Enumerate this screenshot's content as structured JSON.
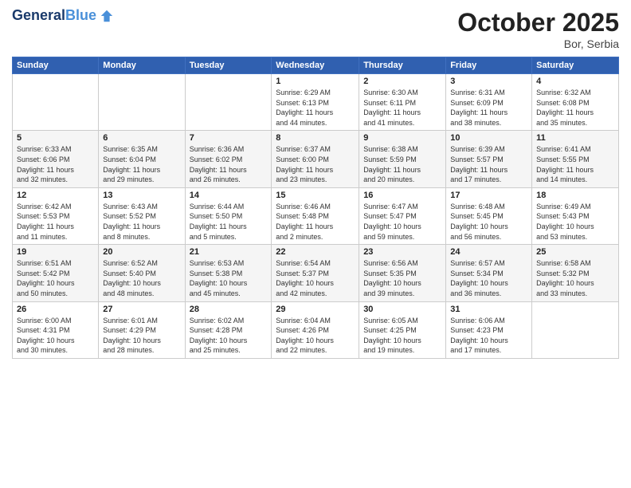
{
  "header": {
    "logo_line1": "General",
    "logo_line2": "Blue",
    "month": "October 2025",
    "location": "Bor, Serbia"
  },
  "days_of_week": [
    "Sunday",
    "Monday",
    "Tuesday",
    "Wednesday",
    "Thursday",
    "Friday",
    "Saturday"
  ],
  "weeks": [
    [
      {
        "day": "",
        "info": ""
      },
      {
        "day": "",
        "info": ""
      },
      {
        "day": "",
        "info": ""
      },
      {
        "day": "1",
        "info": "Sunrise: 6:29 AM\nSunset: 6:13 PM\nDaylight: 11 hours\nand 44 minutes."
      },
      {
        "day": "2",
        "info": "Sunrise: 6:30 AM\nSunset: 6:11 PM\nDaylight: 11 hours\nand 41 minutes."
      },
      {
        "day": "3",
        "info": "Sunrise: 6:31 AM\nSunset: 6:09 PM\nDaylight: 11 hours\nand 38 minutes."
      },
      {
        "day": "4",
        "info": "Sunrise: 6:32 AM\nSunset: 6:08 PM\nDaylight: 11 hours\nand 35 minutes."
      }
    ],
    [
      {
        "day": "5",
        "info": "Sunrise: 6:33 AM\nSunset: 6:06 PM\nDaylight: 11 hours\nand 32 minutes."
      },
      {
        "day": "6",
        "info": "Sunrise: 6:35 AM\nSunset: 6:04 PM\nDaylight: 11 hours\nand 29 minutes."
      },
      {
        "day": "7",
        "info": "Sunrise: 6:36 AM\nSunset: 6:02 PM\nDaylight: 11 hours\nand 26 minutes."
      },
      {
        "day": "8",
        "info": "Sunrise: 6:37 AM\nSunset: 6:00 PM\nDaylight: 11 hours\nand 23 minutes."
      },
      {
        "day": "9",
        "info": "Sunrise: 6:38 AM\nSunset: 5:59 PM\nDaylight: 11 hours\nand 20 minutes."
      },
      {
        "day": "10",
        "info": "Sunrise: 6:39 AM\nSunset: 5:57 PM\nDaylight: 11 hours\nand 17 minutes."
      },
      {
        "day": "11",
        "info": "Sunrise: 6:41 AM\nSunset: 5:55 PM\nDaylight: 11 hours\nand 14 minutes."
      }
    ],
    [
      {
        "day": "12",
        "info": "Sunrise: 6:42 AM\nSunset: 5:53 PM\nDaylight: 11 hours\nand 11 minutes."
      },
      {
        "day": "13",
        "info": "Sunrise: 6:43 AM\nSunset: 5:52 PM\nDaylight: 11 hours\nand 8 minutes."
      },
      {
        "day": "14",
        "info": "Sunrise: 6:44 AM\nSunset: 5:50 PM\nDaylight: 11 hours\nand 5 minutes."
      },
      {
        "day": "15",
        "info": "Sunrise: 6:46 AM\nSunset: 5:48 PM\nDaylight: 11 hours\nand 2 minutes."
      },
      {
        "day": "16",
        "info": "Sunrise: 6:47 AM\nSunset: 5:47 PM\nDaylight: 10 hours\nand 59 minutes."
      },
      {
        "day": "17",
        "info": "Sunrise: 6:48 AM\nSunset: 5:45 PM\nDaylight: 10 hours\nand 56 minutes."
      },
      {
        "day": "18",
        "info": "Sunrise: 6:49 AM\nSunset: 5:43 PM\nDaylight: 10 hours\nand 53 minutes."
      }
    ],
    [
      {
        "day": "19",
        "info": "Sunrise: 6:51 AM\nSunset: 5:42 PM\nDaylight: 10 hours\nand 50 minutes."
      },
      {
        "day": "20",
        "info": "Sunrise: 6:52 AM\nSunset: 5:40 PM\nDaylight: 10 hours\nand 48 minutes."
      },
      {
        "day": "21",
        "info": "Sunrise: 6:53 AM\nSunset: 5:38 PM\nDaylight: 10 hours\nand 45 minutes."
      },
      {
        "day": "22",
        "info": "Sunrise: 6:54 AM\nSunset: 5:37 PM\nDaylight: 10 hours\nand 42 minutes."
      },
      {
        "day": "23",
        "info": "Sunrise: 6:56 AM\nSunset: 5:35 PM\nDaylight: 10 hours\nand 39 minutes."
      },
      {
        "day": "24",
        "info": "Sunrise: 6:57 AM\nSunset: 5:34 PM\nDaylight: 10 hours\nand 36 minutes."
      },
      {
        "day": "25",
        "info": "Sunrise: 6:58 AM\nSunset: 5:32 PM\nDaylight: 10 hours\nand 33 minutes."
      }
    ],
    [
      {
        "day": "26",
        "info": "Sunrise: 6:00 AM\nSunset: 4:31 PM\nDaylight: 10 hours\nand 30 minutes."
      },
      {
        "day": "27",
        "info": "Sunrise: 6:01 AM\nSunset: 4:29 PM\nDaylight: 10 hours\nand 28 minutes."
      },
      {
        "day": "28",
        "info": "Sunrise: 6:02 AM\nSunset: 4:28 PM\nDaylight: 10 hours\nand 25 minutes."
      },
      {
        "day": "29",
        "info": "Sunrise: 6:04 AM\nSunset: 4:26 PM\nDaylight: 10 hours\nand 22 minutes."
      },
      {
        "day": "30",
        "info": "Sunrise: 6:05 AM\nSunset: 4:25 PM\nDaylight: 10 hours\nand 19 minutes."
      },
      {
        "day": "31",
        "info": "Sunrise: 6:06 AM\nSunset: 4:23 PM\nDaylight: 10 hours\nand 17 minutes."
      },
      {
        "day": "",
        "info": ""
      }
    ]
  ]
}
